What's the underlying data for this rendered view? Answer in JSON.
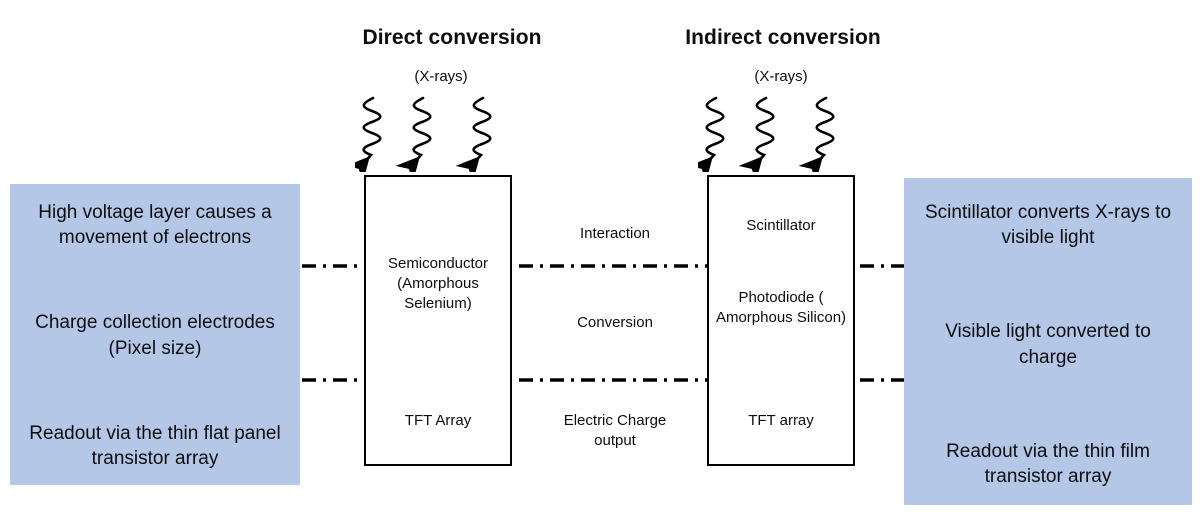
{
  "diagram": {
    "title_left": "Direct conversion",
    "title_right": "Indirect conversion",
    "xray_caption_left": "(X-rays)",
    "xray_caption_right": "(X-rays)",
    "panel_color": "#b4c7e7",
    "line_color": "#000000"
  },
  "left_panel": {
    "items": [
      "High voltage layer causes a movement of electrons",
      "Charge collection electrodes (Pixel size)",
      "Readout via the thin flat panel transistor array"
    ]
  },
  "right_panel": {
    "items": [
      "Scintillator converts X-rays to visible light",
      "Visible light converted to charge",
      "Readout via the thin film transistor array"
    ]
  },
  "direct_stack": {
    "layers": [
      "Semiconductor (Amorphous Selenium)",
      "TFT Array"
    ]
  },
  "indirect_stack": {
    "layers": [
      "Scintillator",
      "Photodiode ( Amorphous Silicon)",
      "TFT array"
    ]
  },
  "process": {
    "steps": [
      "Interaction",
      "Conversion",
      "Electric Charge output"
    ]
  }
}
